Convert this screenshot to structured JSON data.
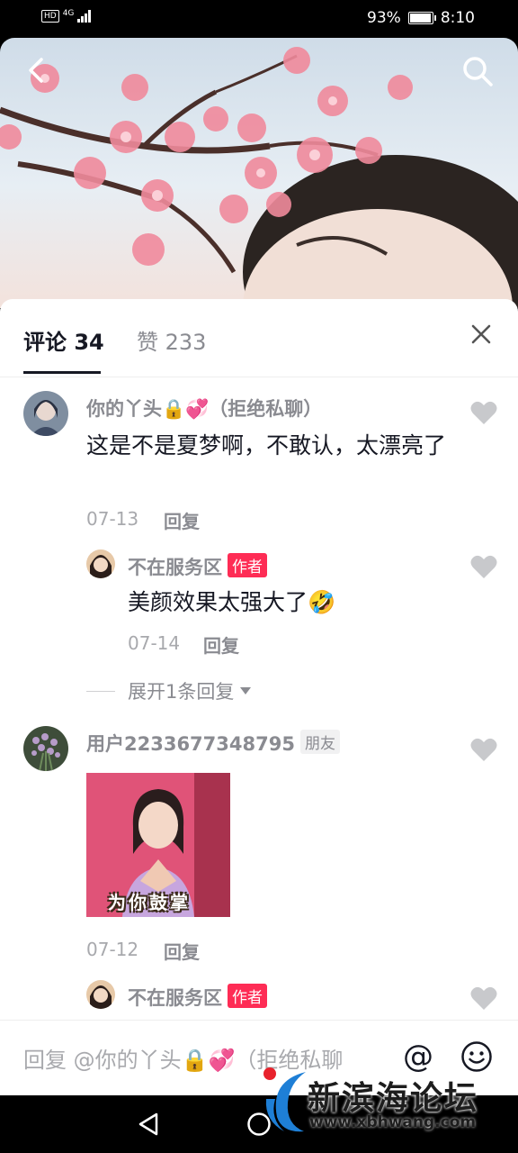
{
  "status_bar": {
    "network": "HD",
    "signal_type": "4G",
    "battery": "93%",
    "time": "8:10"
  },
  "header": {
    "back_icon": "chevron-left-icon",
    "search_icon": "search-icon"
  },
  "tabs": [
    {
      "label": "评论 34",
      "active": true
    },
    {
      "label": "赞 233",
      "active": false
    }
  ],
  "comments": [
    {
      "user": "你的丫头🔒💞（拒绝私聊）",
      "text": "这是不是夏梦啊，不敢认，太漂亮了",
      "date": "07-13",
      "reply_label": "回复",
      "replies": [
        {
          "user": "不在服务区",
          "badge": "作者",
          "text": "美颜效果太强大了🤣",
          "date": "07-14",
          "reply_label": "回复"
        }
      ],
      "expand_label": "展开1条回复"
    },
    {
      "user": "用户2233677348795",
      "badge": "朋友",
      "sticker_caption": "为你鼓掌",
      "date": "07-12",
      "reply_label": "回复",
      "replies": [
        {
          "user": "不在服务区",
          "badge": "作者"
        }
      ]
    }
  ],
  "input": {
    "placeholder": "回复 @你的丫头🔒💞（拒绝私聊"
  },
  "watermark": {
    "title": "新滨海论坛",
    "url": "www.xbhwang.com"
  },
  "colors": {
    "accent": "#fe2c55",
    "text": "#161823",
    "muted": "#8a8b91"
  }
}
